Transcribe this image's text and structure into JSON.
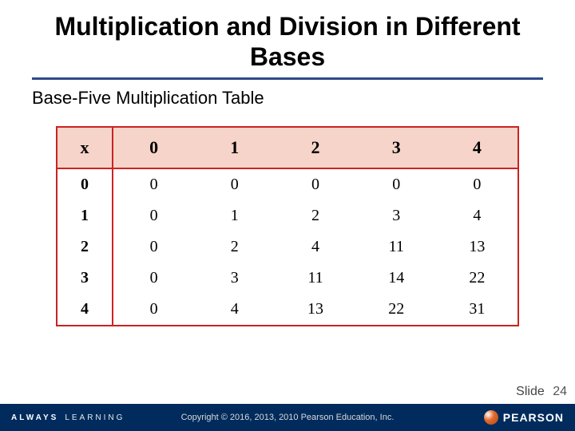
{
  "title": "Multiplication and Division in Different Bases",
  "subtitle": "Base-Five Multiplication Table",
  "table": {
    "corner": "x",
    "col_headers": [
      "0",
      "1",
      "2",
      "3",
      "4"
    ],
    "row_headers": [
      "0",
      "1",
      "2",
      "3",
      "4"
    ],
    "rows": [
      [
        "0",
        "0",
        "0",
        "0",
        "0"
      ],
      [
        "0",
        "1",
        "2",
        "3",
        "4"
      ],
      [
        "0",
        "2",
        "4",
        "11",
        "13"
      ],
      [
        "0",
        "3",
        "11",
        "14",
        "22"
      ],
      [
        "0",
        "4",
        "13",
        "22",
        "31"
      ]
    ]
  },
  "footer": {
    "always": "ALWAYS",
    "learning": "LEARNING",
    "copyright": "Copyright © 2016, 2013, 2010 Pearson Education, Inc.",
    "brand": "PEARSON"
  },
  "slide": {
    "label": "Slide",
    "number": "24"
  },
  "chart_data": {
    "type": "table",
    "title": "Base-Five Multiplication Table",
    "columns": [
      "x",
      "0",
      "1",
      "2",
      "3",
      "4"
    ],
    "rows": [
      [
        "0",
        "0",
        "0",
        "0",
        "0",
        "0"
      ],
      [
        "1",
        "0",
        "1",
        "2",
        "3",
        "4"
      ],
      [
        "2",
        "0",
        "2",
        "4",
        "11",
        "13"
      ],
      [
        "3",
        "0",
        "3",
        "11",
        "14",
        "22"
      ],
      [
        "4",
        "0",
        "4",
        "13",
        "22",
        "31"
      ]
    ]
  }
}
